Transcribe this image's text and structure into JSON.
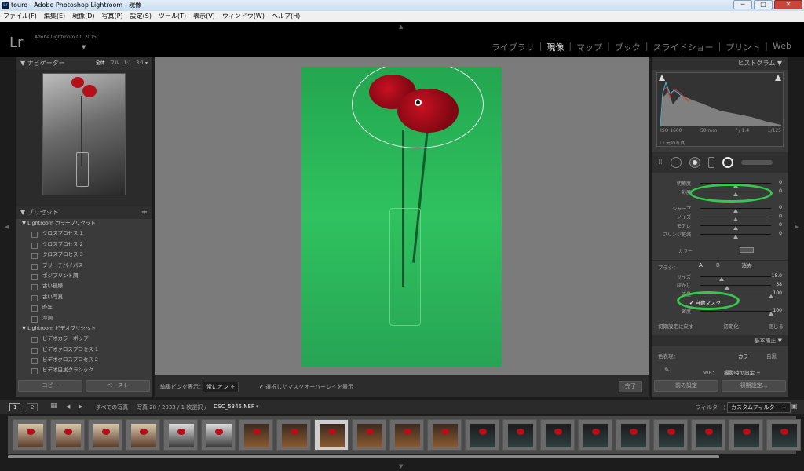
{
  "window": {
    "title": "touro - Adobe Photoshop Lightroom - 現像",
    "minimize": "─",
    "restore": "□",
    "close": "✕",
    "app_icon": "Lr"
  },
  "menu": [
    "ファイル(F)",
    "編集(E)",
    "現像(D)",
    "写真(P)",
    "設定(S)",
    "ツール(T)",
    "表示(V)",
    "ウィンドウ(W)",
    "ヘルプ(H)"
  ],
  "identity": {
    "logo": "Lr",
    "product": "Adobe Lightroom CC 2015",
    "dropdown": "▼"
  },
  "modules": [
    "ライブラリ",
    "現像",
    "マップ",
    "ブック",
    "スライドショー",
    "プリント",
    "Web"
  ],
  "active_module": "現像",
  "left_panel": {
    "navigator": {
      "title": "▼ ナビゲーター",
      "zoom": [
        "全体",
        "フル",
        "1:1",
        "3:1 ▾"
      ]
    },
    "presets": {
      "title": "▼ プリセット",
      "add": "+",
      "groups": [
        {
          "name": "▼ Lightroom カラープリセット",
          "items": [
            "クロスプロセス 1",
            "クロスプロセス 2",
            "クロスプロセス 3",
            "ブリーチバイパス",
            "ポジプリント調",
            "古い褪緑",
            "古い写真",
            "昨年",
            "冷調"
          ]
        },
        {
          "name": "▼ Lightroom ビデオプリセット",
          "items": [
            "ビデオカラーポップ",
            "ビデオクロスプロセス 1",
            "ビデオクロスプロセス 2",
            "ビデオ白黒クラシック"
          ]
        }
      ]
    },
    "copy": "コピー",
    "paste": "ペースト"
  },
  "toolbar": {
    "pin_label": "編集ピンを表示：",
    "pin_value": "常にオン ÷",
    "overlay_check": "✔ 選択したマスクオーバーレイを表示",
    "done": "完了"
  },
  "right_panel": {
    "histogram_title": "ヒストグラム ▼",
    "histogram_info": [
      "ISO 1600",
      "50 mm",
      "ƒ / 1.4",
      "1/125"
    ],
    "original_photo": "元の写真",
    "sliders_top": [
      {
        "name": "明瞭度",
        "value": "0",
        "level": 0.5
      },
      {
        "name": "彩度",
        "value": "0",
        "level": 0.5
      }
    ],
    "sliders_detail": [
      {
        "name": "シャープ",
        "value": "0",
        "level": 0.5
      },
      {
        "name": "ノイズ",
        "value": "0",
        "level": 0.5
      },
      {
        "name": "モアレ",
        "value": "0",
        "level": 0.5
      },
      {
        "name": "フリンジ軽減",
        "value": "0",
        "level": 0.5
      }
    ],
    "color_label": "カラー",
    "brush": {
      "label": "ブラシ：",
      "a": "A",
      "b": "B",
      "erase": "消去"
    },
    "brush_sliders": [
      {
        "name": "サイズ",
        "value": "15.0",
        "level": 0.3
      },
      {
        "name": "ぼかし",
        "value": "38",
        "level": 0.38
      },
      {
        "name": "流量",
        "value": "100",
        "level": 1.0
      }
    ],
    "auto_mask": "✔ 自動マスク",
    "density": {
      "name": "密度",
      "value": "100",
      "level": 1.0
    },
    "reset_buttons": [
      "初期設定に戻す",
      "初期化",
      "閉じる"
    ],
    "basic_title": "基本補正 ▼",
    "treatment_label": "色表現：",
    "treatment_color": "カラー",
    "treatment_bw": "白黒",
    "wb_label": "WB：",
    "wb_value": "撮影時の設定 ÷",
    "prev": "前の設定",
    "reset": "初期設定..."
  },
  "filmstrip_bar": {
    "screens": [
      "1",
      "2"
    ],
    "grid": "▦",
    "back": "◀",
    "forward": "▶",
    "source": "すべての写真",
    "info": "写真 28 / 2033 / 1 枚選択 /",
    "filename": "DSC_5345.NEF",
    "filename_arrow": "▾",
    "filter_label": "フィルター：",
    "filter_value": "カスタムフィルター ÷"
  },
  "thumb_count": 21,
  "selected_thumb": 8,
  "colors": {
    "mask": "#2fc25f",
    "accent_ring": "#34c94a",
    "rose": "#b3101a"
  }
}
